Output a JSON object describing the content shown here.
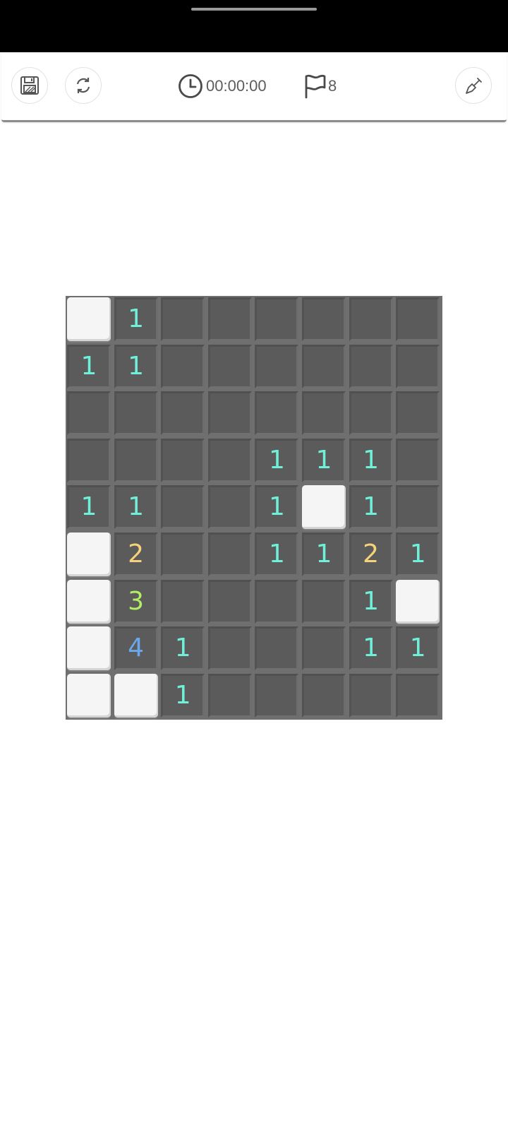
{
  "toolbar": {
    "timer": "00:00:00",
    "flags": "8",
    "icons": {
      "save": "save-floppy-icon",
      "restart": "restart-icon",
      "timer": "clock-icon",
      "flag": "flag-icon",
      "tool": "shovel-icon"
    }
  },
  "board": {
    "rows": 9,
    "cols": 8,
    "cells": [
      [
        "C",
        "1",
        "",
        "",
        "",
        "",
        "",
        ""
      ],
      [
        "1",
        "1",
        "",
        "",
        "",
        "",
        "",
        ""
      ],
      [
        "",
        "",
        "",
        "",
        "",
        "",
        "",
        ""
      ],
      [
        "",
        "",
        "",
        "",
        "1",
        "1",
        "1",
        ""
      ],
      [
        "1",
        "1",
        "",
        "",
        "1",
        "C",
        "1",
        ""
      ],
      [
        "C",
        "2",
        "",
        "",
        "1",
        "1",
        "2",
        "1"
      ],
      [
        "C",
        "3",
        "",
        "",
        "",
        "",
        "1",
        "C"
      ],
      [
        "C",
        "4",
        "1",
        "",
        "",
        "",
        "1",
        "1"
      ],
      [
        "C",
        "C",
        "1",
        "",
        "",
        "",
        "",
        ""
      ]
    ],
    "number_colors": {
      "1": "#6ff0d8",
      "2": "#f6d27a",
      "3": "#b2ef64",
      "4": "#6aa8ec"
    }
  }
}
